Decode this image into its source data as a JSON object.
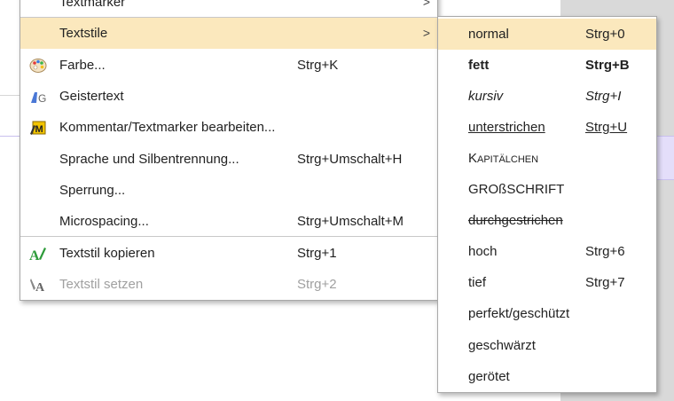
{
  "main_menu": {
    "top_item": {
      "label": "Textmarker",
      "arrow": ">"
    },
    "items": [
      {
        "label": "Textstile",
        "shortcut": "",
        "arrow": ">",
        "icon": ""
      },
      {
        "label": "Farbe...",
        "shortcut": "Strg+K",
        "icon": "palette-icon"
      },
      {
        "label": "Geistertext",
        "shortcut": "",
        "icon": "ghost-text-icon"
      },
      {
        "label": "Kommentar/Textmarker bearbeiten...",
        "shortcut": "",
        "icon": "comment-marker-icon"
      },
      {
        "label": "Sprache und Silbentrennung...",
        "shortcut": "Strg+Umschalt+H",
        "icon": ""
      },
      {
        "label": "Sperrung...",
        "shortcut": "",
        "icon": ""
      },
      {
        "label": "Microspacing...",
        "shortcut": "Strg+Umschalt+M",
        "icon": ""
      },
      {
        "label": "Textstil kopieren",
        "shortcut": "Strg+1",
        "icon": "copy-style-icon"
      },
      {
        "label": "Textstil setzen",
        "shortcut": "Strg+2",
        "icon": "apply-style-icon"
      }
    ]
  },
  "sub_menu": {
    "items": [
      {
        "label": "normal",
        "shortcut": "Strg+0"
      },
      {
        "label": "fett",
        "shortcut": "Strg+B"
      },
      {
        "label": "kursiv",
        "shortcut": "Strg+I"
      },
      {
        "label": "unterstrichen",
        "shortcut": "Strg+U"
      },
      {
        "label": "Kapitälchen",
        "shortcut": ""
      },
      {
        "label": "GROßSCHRIFT",
        "shortcut": ""
      },
      {
        "label": "durchgestrichen",
        "shortcut": ""
      },
      {
        "label": "hoch",
        "shortcut": "Strg+6"
      },
      {
        "label": "tief",
        "shortcut": "Strg+7"
      },
      {
        "label": "perfekt/geschützt",
        "shortcut": ""
      },
      {
        "label": "geschwärzt",
        "shortcut": ""
      },
      {
        "label": "gerötet",
        "shortcut": ""
      }
    ]
  },
  "colors": {
    "highlight": "#fbe8bd",
    "disabled_text": "#a0a0a0"
  }
}
